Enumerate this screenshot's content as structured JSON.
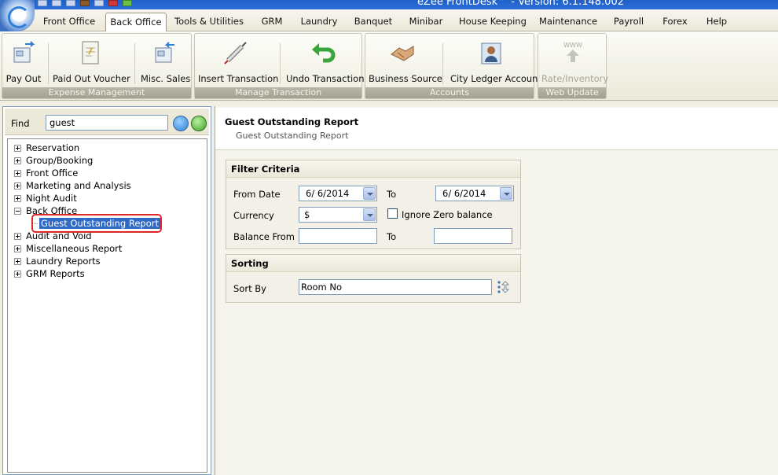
{
  "window": {
    "title": "eZee FrontDesk™ - Version: 6.1.148.002"
  },
  "menu_tabs": [
    {
      "label": "Front Office"
    },
    {
      "label": "Back Office"
    },
    {
      "label": "Tools & Utilities"
    },
    {
      "label": "GRM"
    },
    {
      "label": "Laundry"
    },
    {
      "label": "Banquet"
    },
    {
      "label": "Minibar"
    },
    {
      "label": "House Keeping"
    },
    {
      "label": "Maintenance"
    },
    {
      "label": "Payroll"
    },
    {
      "label": "Forex"
    },
    {
      "label": "Help"
    }
  ],
  "active_tab": "Back Office",
  "ribbon": {
    "groups": [
      {
        "name": "Expense Management",
        "buttons": [
          {
            "label": "Pay Out"
          },
          {
            "label": "Paid Out Voucher"
          },
          {
            "label": "Misc. Sales"
          }
        ]
      },
      {
        "name": "Manage Transaction",
        "buttons": [
          {
            "label": "Insert Transaction"
          },
          {
            "label": "Undo Transaction"
          }
        ]
      },
      {
        "name": "Accounts",
        "buttons": [
          {
            "label": "Business Source"
          },
          {
            "label": "City Ledger Account"
          }
        ]
      },
      {
        "name": "Web Update",
        "buttons": [
          {
            "label": "Rate/Inventory"
          }
        ]
      }
    ],
    "web_update_icon_text": "WWW"
  },
  "left_panel": {
    "find_label": "Find",
    "find_value": "guest",
    "tree": [
      {
        "label": "Reservation",
        "expanded": false
      },
      {
        "label": "Group/Booking",
        "expanded": false
      },
      {
        "label": "Front Office",
        "expanded": false
      },
      {
        "label": "Marketing and Analysis",
        "expanded": false
      },
      {
        "label": "Night Audit",
        "expanded": false
      },
      {
        "label": "Back Office",
        "expanded": true
      },
      {
        "label": "Guest Outstanding Report",
        "selected": true
      },
      {
        "label": "Audit and Void",
        "expanded": false
      },
      {
        "label": "Miscellaneous Report",
        "expanded": false
      },
      {
        "label": "Laundry Reports",
        "expanded": false
      },
      {
        "label": "GRM Reports",
        "expanded": false
      }
    ]
  },
  "report": {
    "title": "Guest Outstanding Report",
    "subtitle": "Guest Outstanding Report",
    "filter": {
      "heading": "Filter Criteria",
      "from_date_label": "From Date",
      "from_date": "6/  6/2014",
      "to_label": "To",
      "to_date": "6/  6/2014",
      "currency_label": "Currency",
      "currency_value": "$",
      "ignore_zero_label": "Ignore Zero balance",
      "ignore_zero_checked": false,
      "balance_from_label": "Balance From",
      "balance_from_value": "",
      "balance_to_label": "To",
      "balance_to_value": ""
    },
    "sorting": {
      "heading": "Sorting",
      "sort_by_label": "Sort By",
      "sort_by_value": "Room No"
    }
  },
  "colors": {
    "selection": "#316ac5",
    "highlight_box": "#e0282b",
    "title_bar": "#2d6fd8"
  }
}
